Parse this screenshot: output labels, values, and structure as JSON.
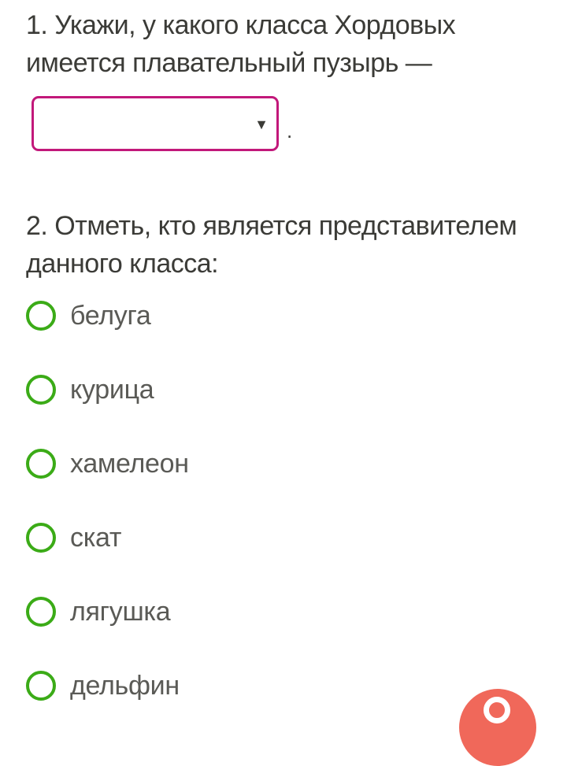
{
  "question1": {
    "text": "1. Укажи, у какого класса Хордовых имеется плавательный пузырь —",
    "select": {
      "value": "",
      "arrow": "▼"
    },
    "trailing": "."
  },
  "question2": {
    "text": "2. Отметь, кто является представителем данного класса:",
    "options": [
      {
        "label": "белуга",
        "checked": false
      },
      {
        "label": "курица",
        "checked": false
      },
      {
        "label": "хамелеон",
        "checked": false
      },
      {
        "label": "скат",
        "checked": false
      },
      {
        "label": "лягушка",
        "checked": false
      },
      {
        "label": "дельфин",
        "checked": false
      }
    ]
  },
  "colors": {
    "select_border": "#c2187a",
    "radio_border": "#3bab17",
    "fab_background": "#f0685a",
    "text": "#3b3b37"
  },
  "icons": {
    "select_arrow": "dropdown-arrow-icon",
    "radio": "radio-button-icon",
    "fab": "help-fab-icon"
  }
}
